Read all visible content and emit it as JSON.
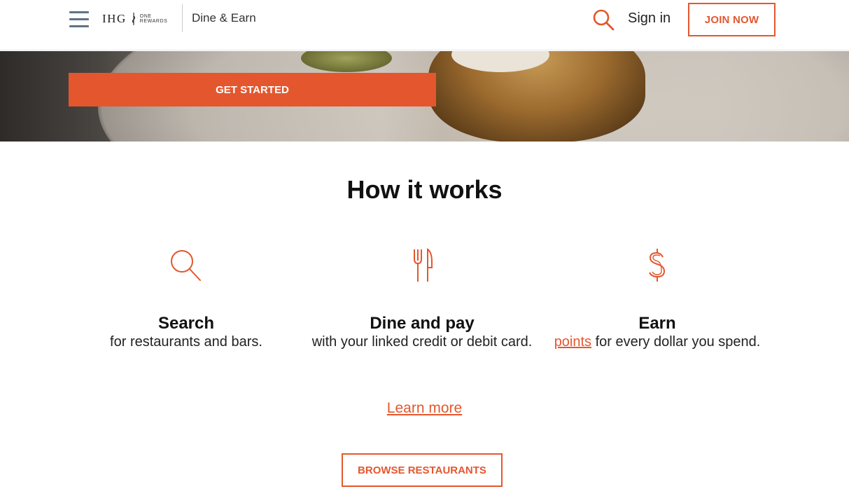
{
  "header": {
    "brand": {
      "ihg": "IHG",
      "sub_line1": "ONE",
      "sub_line2": "REWARDS",
      "product": "Dine & Earn"
    },
    "sign_in": "Sign in",
    "join_now": "JOIN NOW",
    "icons": {
      "menu": "hamburger-menu-icon",
      "search": "search-icon"
    }
  },
  "hero": {
    "get_started": "GET STARTED"
  },
  "how_it_works": {
    "title": "How it works",
    "steps": [
      {
        "icon": "magnifier-icon",
        "title": "Search",
        "text": "for restaurants and bars."
      },
      {
        "icon": "fork-knife-icon",
        "title": "Dine and pay",
        "text": "with your linked credit or debit card."
      },
      {
        "icon": "dollar-icon",
        "title": "Earn",
        "link": "points",
        "text": " for every dollar you spend."
      }
    ],
    "learn_more": "Learn more",
    "browse": "BROWSE RESTAURANTS"
  },
  "colors": {
    "accent": "#e4572e",
    "menu_icon": "#5f7385"
  }
}
